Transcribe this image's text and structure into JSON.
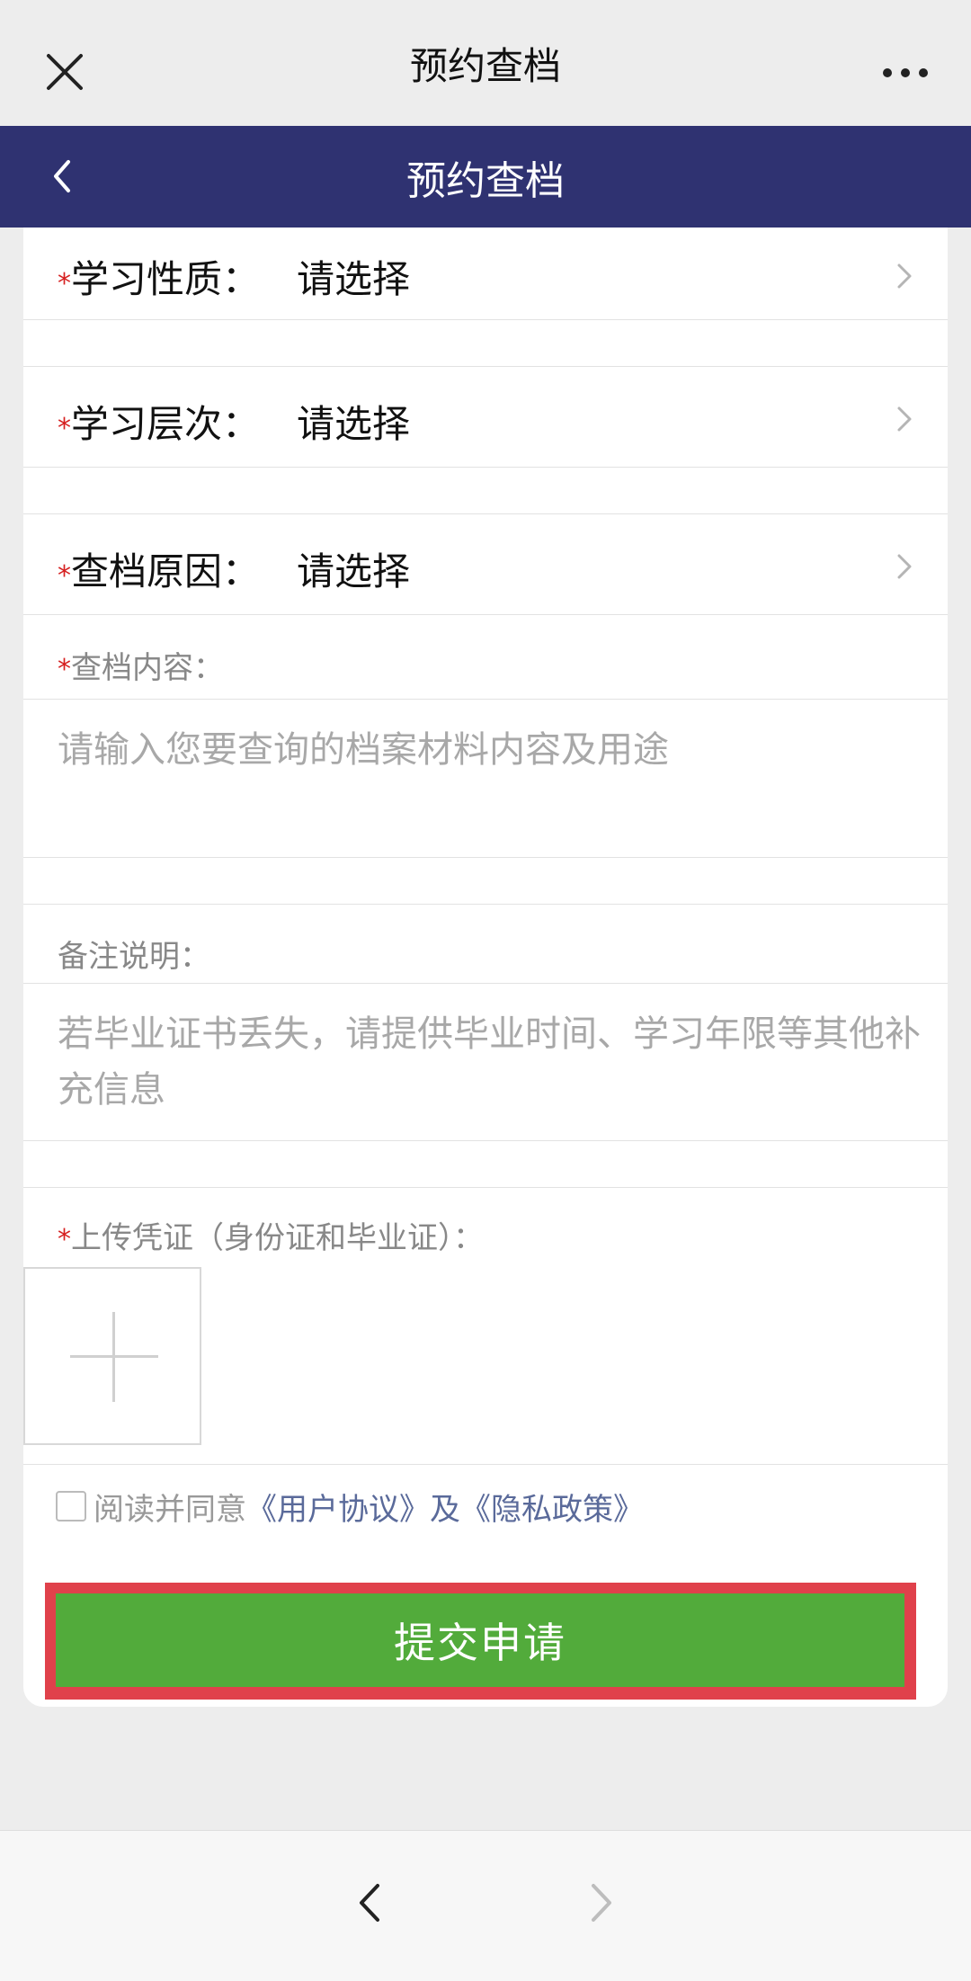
{
  "wechat_bar": {
    "title": "预约查档"
  },
  "header": {
    "title": "预约查档"
  },
  "form": {
    "required_mark": "*",
    "study_nature": {
      "label": "学习性质：",
      "value": "请选择"
    },
    "study_level": {
      "label": "学习层次：",
      "value": "请选择"
    },
    "reason": {
      "label": "查档原因：",
      "value": "请选择"
    },
    "content": {
      "label": "查档内容：",
      "placeholder": "请输入您要查询的档案材料内容及用途"
    },
    "remark": {
      "label": "备注说明：",
      "placeholder": "若毕业证书丢失，请提供毕业时间、学习年限等其他补充信息"
    },
    "upload": {
      "label": "上传凭证（身份证和毕业证）："
    },
    "agreement": {
      "prefix": "阅读并同意",
      "user_agreement": "《用户协议》",
      "and": "及",
      "privacy_policy": "《隐私政策》",
      "checked": false
    },
    "submit_label": "提交申请"
  },
  "colors": {
    "header_bg": "#2f3271",
    "submit_bg": "#52ab3b",
    "highlight": "#e0414b",
    "required": "#d62020"
  },
  "icons": [
    "close-icon",
    "more-icon",
    "back-icon",
    "chevron-right-icon",
    "plus-icon",
    "nav-back-icon",
    "nav-forward-icon"
  ]
}
